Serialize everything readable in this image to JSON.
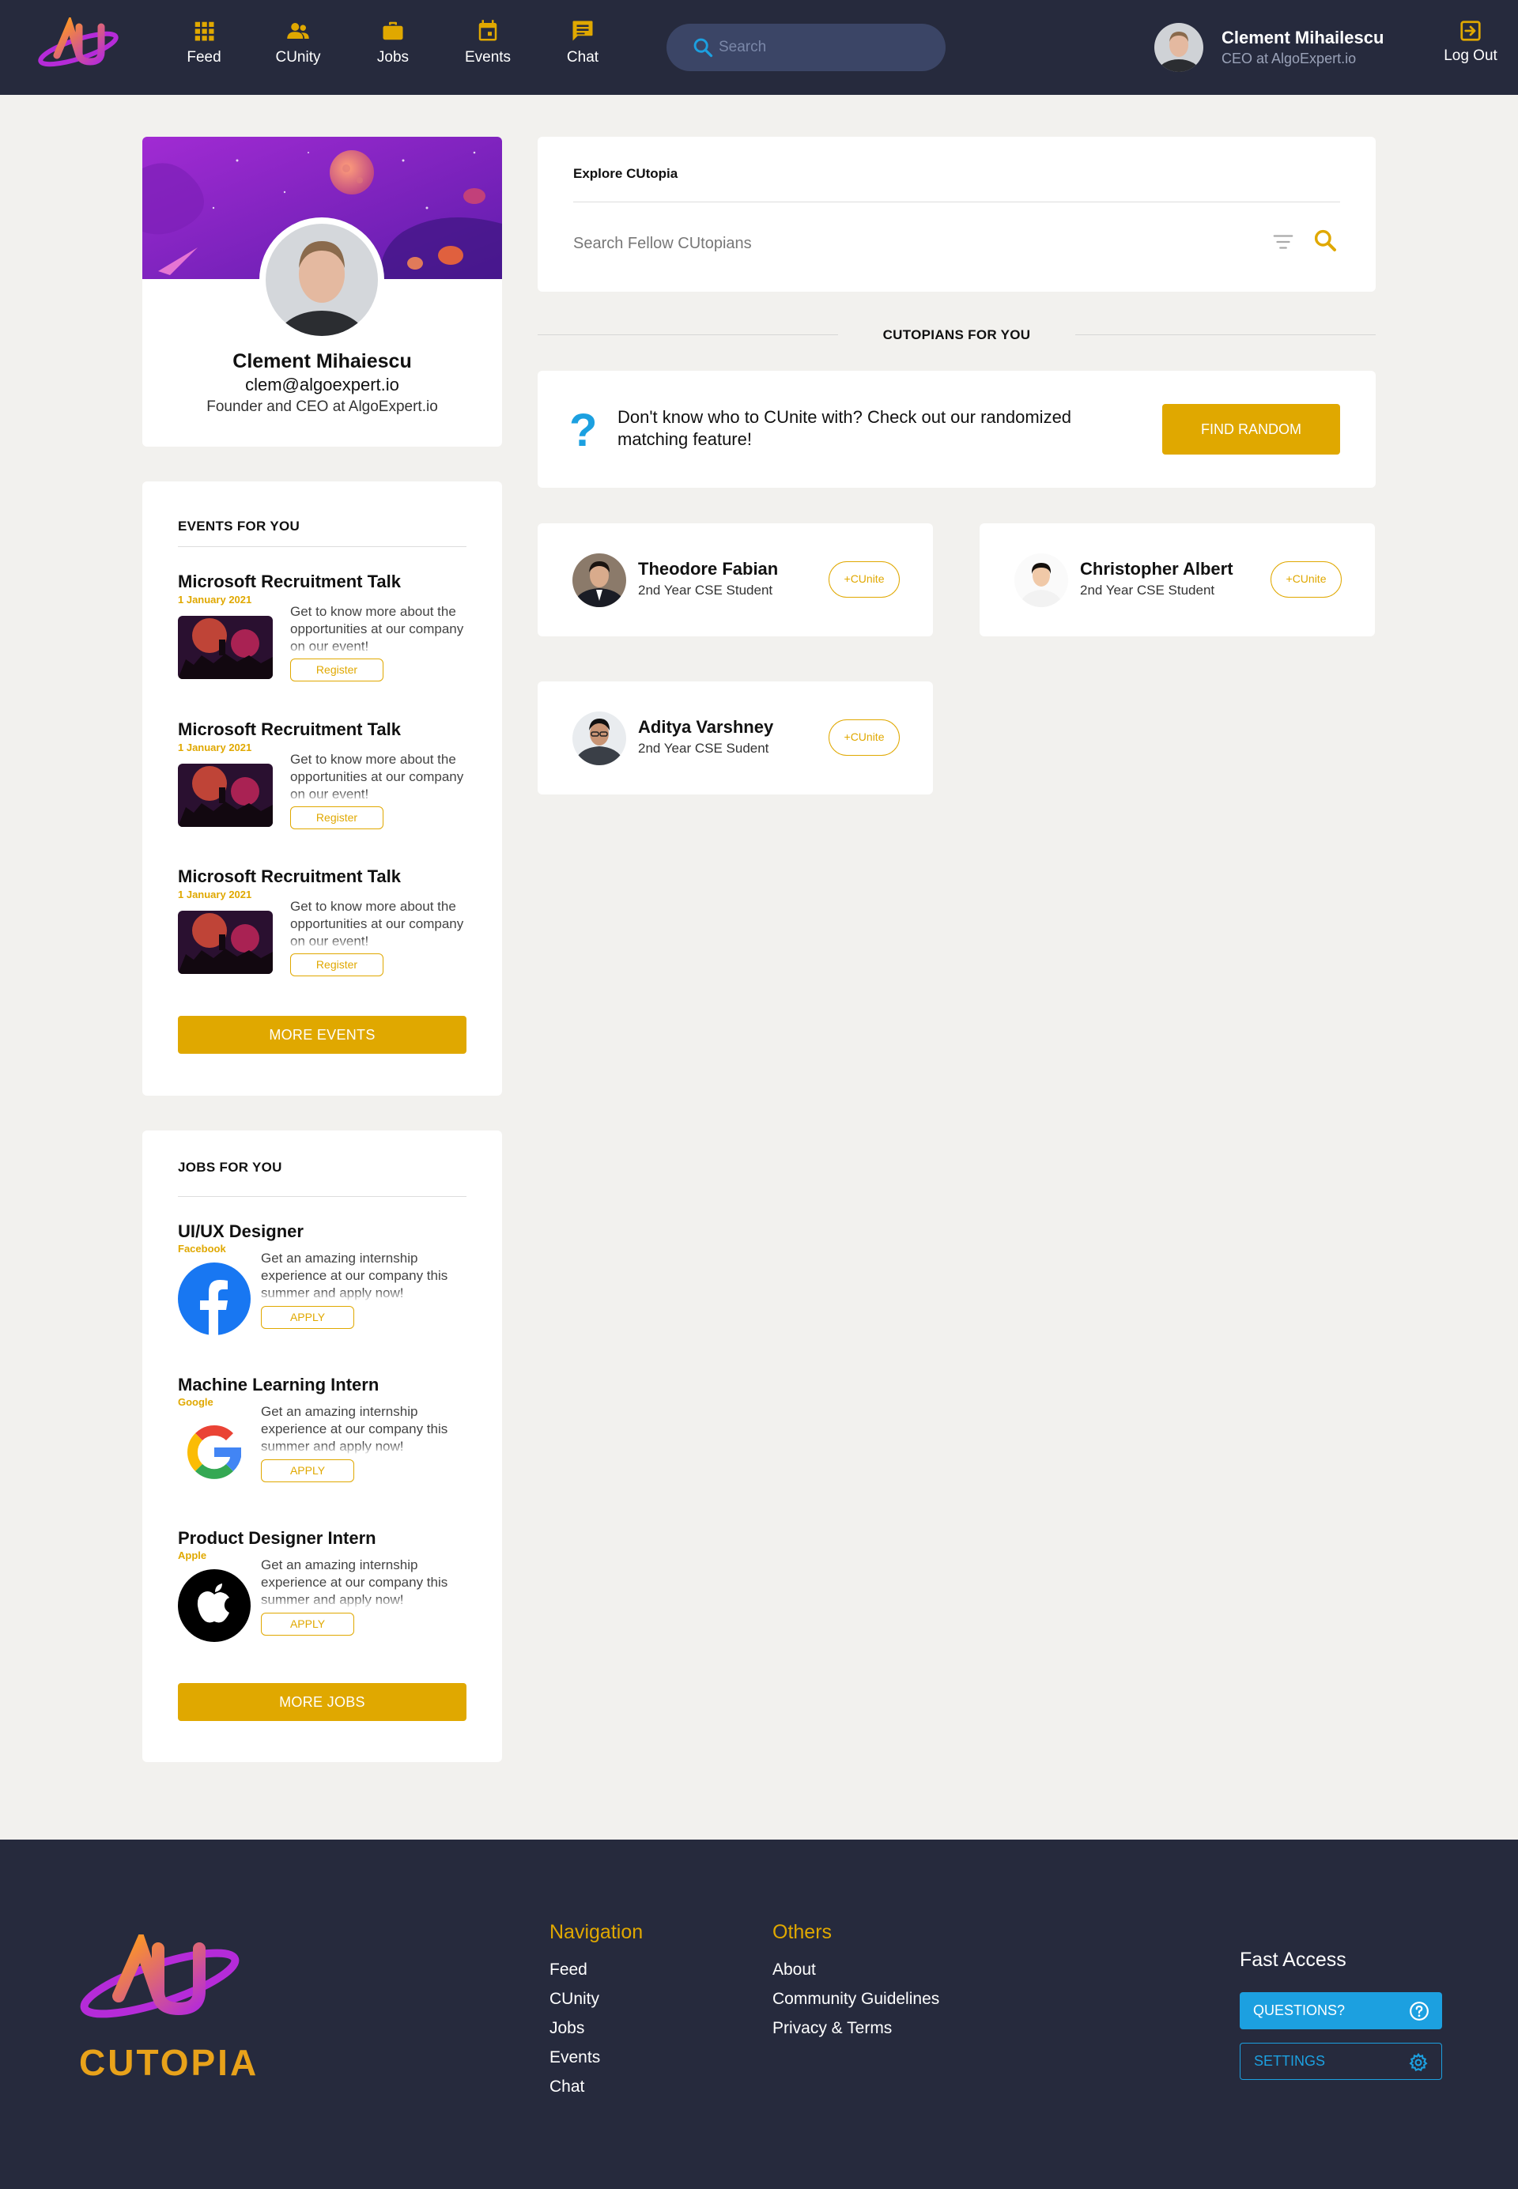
{
  "nav": {
    "items": [
      {
        "label": "Feed",
        "icon": "grid-icon"
      },
      {
        "label": "CUnity",
        "icon": "people-icon"
      },
      {
        "label": "Jobs",
        "icon": "briefcase-icon"
      },
      {
        "label": "Events",
        "icon": "calendar-icon"
      },
      {
        "label": "Chat",
        "icon": "chat-icon"
      }
    ],
    "search_placeholder": "Search",
    "user_name": "Clement Mihailescu",
    "user_role": "CEO at AlgoExpert.io",
    "logout_label": "Log Out"
  },
  "profile": {
    "name": "Clement Mihaiescu",
    "email": "clem@algoexpert.io",
    "role": "Founder and CEO at AlgoExpert.io"
  },
  "events": {
    "title": "EVENTS FOR YOU",
    "items": [
      {
        "title": "Microsoft Recruitment Talk",
        "date": "1 January 2021",
        "desc": "Get to know more about the opportunities at our company on our event!",
        "button": "Register"
      },
      {
        "title": "Microsoft Recruitment Talk",
        "date": "1 January 2021",
        "desc": "Get to know more about the opportunities at our company on our event!",
        "button": "Register"
      },
      {
        "title": "Microsoft Recruitment Talk",
        "date": "1 January 2021",
        "desc": "Get to know more about the opportunities at our company on our event!",
        "button": "Register"
      }
    ],
    "more_label": "MORE EVENTS"
  },
  "jobs": {
    "title": "JOBS FOR YOU",
    "items": [
      {
        "title": "UI/UX Designer",
        "company": "Facebook",
        "desc": "Get an amazing internship experience at our company this summer and apply now!",
        "button": "APPLY"
      },
      {
        "title": "Machine Learning Intern",
        "company": "Google",
        "desc": "Get an amazing internship experience at our company this summer and apply now!",
        "button": "APPLY"
      },
      {
        "title": "Product Designer Intern",
        "company": "Apple",
        "desc": "Get an amazing internship experience at our company this summer and apply now!",
        "button": "APPLY"
      }
    ],
    "more_label": "MORE JOBS"
  },
  "explore": {
    "title": "Explore CUtopia",
    "search_placeholder": "Search Fellow CUtopians"
  },
  "cutopians": {
    "title": "CUTOPIANS FOR YOU",
    "random_text": "Don't know who to CUnite with? Check out our randomized matching feature!",
    "random_button": "FIND RANDOM",
    "people": [
      {
        "name": "Theodore Fabian",
        "subtitle": "2nd Year CSE Student",
        "button": "+CUnite"
      },
      {
        "name": "Christopher Albert",
        "subtitle": "2nd Year CSE Student",
        "button": "+CUnite"
      },
      {
        "name": "Aditya Varshney",
        "subtitle": "2nd Year CSE Sudent",
        "button": "+CUnite"
      }
    ]
  },
  "footer": {
    "brand": "CUTOPIA",
    "navigation_title": "Navigation",
    "navigation_links": [
      "Feed",
      "CUnity",
      "Jobs",
      "Events",
      "Chat"
    ],
    "others_title": "Others",
    "others_links": [
      "About",
      "Community Guidelines",
      "Privacy & Terms"
    ],
    "fast_access_title": "Fast Access",
    "questions_label": "QUESTIONS?",
    "settings_label": "SETTINGS"
  },
  "colors": {
    "nav_bg": "#262a3d",
    "accent": "#e0a800",
    "blue": "#1ca0e0",
    "page_bg": "#f2f1ee"
  }
}
